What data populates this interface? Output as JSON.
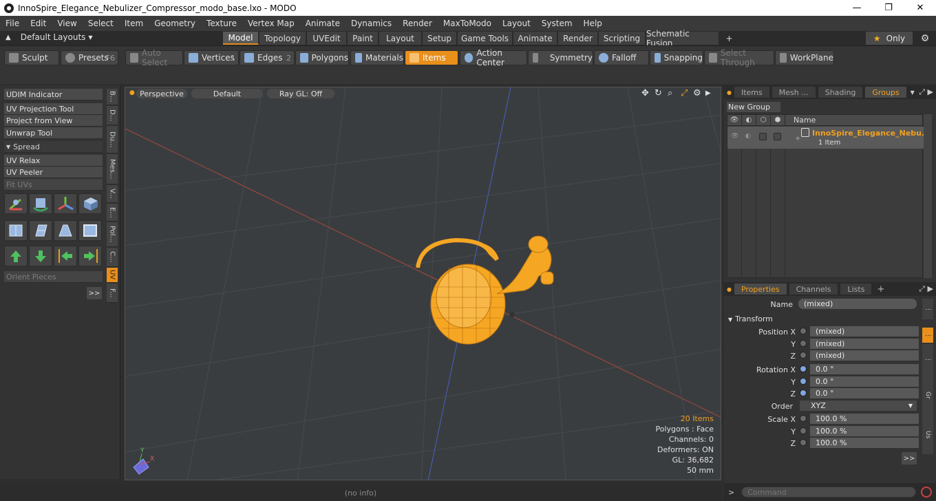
{
  "window": {
    "title": "InnoSpire_Elegance_Nebulizer_Compressor_modo_base.lxo - MODO",
    "minimize": "—",
    "maximize": "❐",
    "close": "✕"
  },
  "menu": [
    "File",
    "Edit",
    "View",
    "Select",
    "Item",
    "Geometry",
    "Texture",
    "Vertex Map",
    "Animate",
    "Dynamics",
    "Render",
    "MaxToModo",
    "Layout",
    "System",
    "Help"
  ],
  "layouts": {
    "label": "Default Layouts",
    "tabs": [
      "Model",
      "Topology",
      "UVEdit",
      "Paint",
      "Layout",
      "Setup",
      "Game Tools",
      "Animate",
      "Render",
      "Scripting",
      "Schematic Fusion"
    ],
    "active": "Model",
    "add": "+",
    "only": "Only"
  },
  "toolbar": {
    "sculpt": "Sculpt",
    "presets": "Presets",
    "presets_key": "F6",
    "auto_select": "Auto Select",
    "vertices": "Vertices",
    "vertices_key": "1",
    "edges": "Edges",
    "edges_key": "2",
    "polygons": "Polygons",
    "materials": "Materials",
    "items": "Items",
    "action_center": "Action Center",
    "symmetry": "Symmetry",
    "falloff": "Falloff",
    "snapping": "Snapping",
    "select_through": "Select Through",
    "workplane": "WorkPlane"
  },
  "left_panel": {
    "udim": "UDIM Indicator",
    "uv_projection": "UV Projection Tool",
    "project_from_view": "Project from View",
    "unwrap": "Unwrap Tool",
    "spread": "Spread",
    "uv_relax": "UV Relax",
    "uv_peeler": "UV Peeler",
    "fit_uvs": "Fit UVs",
    "orient_pieces": "Orient Pieces",
    "more": ">>",
    "vtabs": [
      "B...",
      "D...",
      "Du...",
      "Mes...",
      "V...",
      "E...",
      "Pol...",
      "C...",
      "UV",
      "F..."
    ]
  },
  "viewport": {
    "view": "Perspective",
    "shading": "Default",
    "raygl": "Ray GL: Off",
    "info": {
      "items": "20 Items",
      "polygons": "Polygons : Face",
      "channels": "Channels: 0",
      "deformers": "Deformers: ON",
      "gl": "GL: 36,682",
      "lens": "50 mm"
    },
    "axis_y": "Y",
    "axis_x": "X"
  },
  "status": "(no info)",
  "groups_panel": {
    "tabs": [
      "Items",
      "Mesh ...",
      "Shading",
      "Groups"
    ],
    "active": "Groups",
    "new_group": "New Group",
    "name_col": "Name",
    "group_name": "InnoSpire_Elegance_Nebu...",
    "group_count": "1 Item"
  },
  "properties_panel": {
    "tabs": [
      "Properties",
      "Channels",
      "Lists"
    ],
    "active": "Properties",
    "add": "+",
    "name_label": "Name",
    "name_value": "(mixed)",
    "transform": "Transform",
    "position_x_label": "Position X",
    "y_label": "Y",
    "z_label": "Z",
    "position_x": "(mixed)",
    "position_y": "(mixed)",
    "position_z": "(mixed)",
    "rotation_x_label": "Rotation X",
    "rotation_x": "0.0 °",
    "rotation_y": "0.0 °",
    "rotation_z": "0.0 °",
    "order_label": "Order",
    "order_value": "XYZ",
    "scale_x_label": "Scale X",
    "scale_x": "100.0 %",
    "scale_y": "100.0 %",
    "scale_z": "100.0 %",
    "more": ">>",
    "side_gr": "Gr",
    "side_us": "Us"
  },
  "command": {
    "prompt": ">",
    "placeholder": "Command"
  },
  "colors": {
    "accent": "#e88f1c",
    "selection": "#f5a623",
    "viewport_bg": "#3a3d40"
  }
}
